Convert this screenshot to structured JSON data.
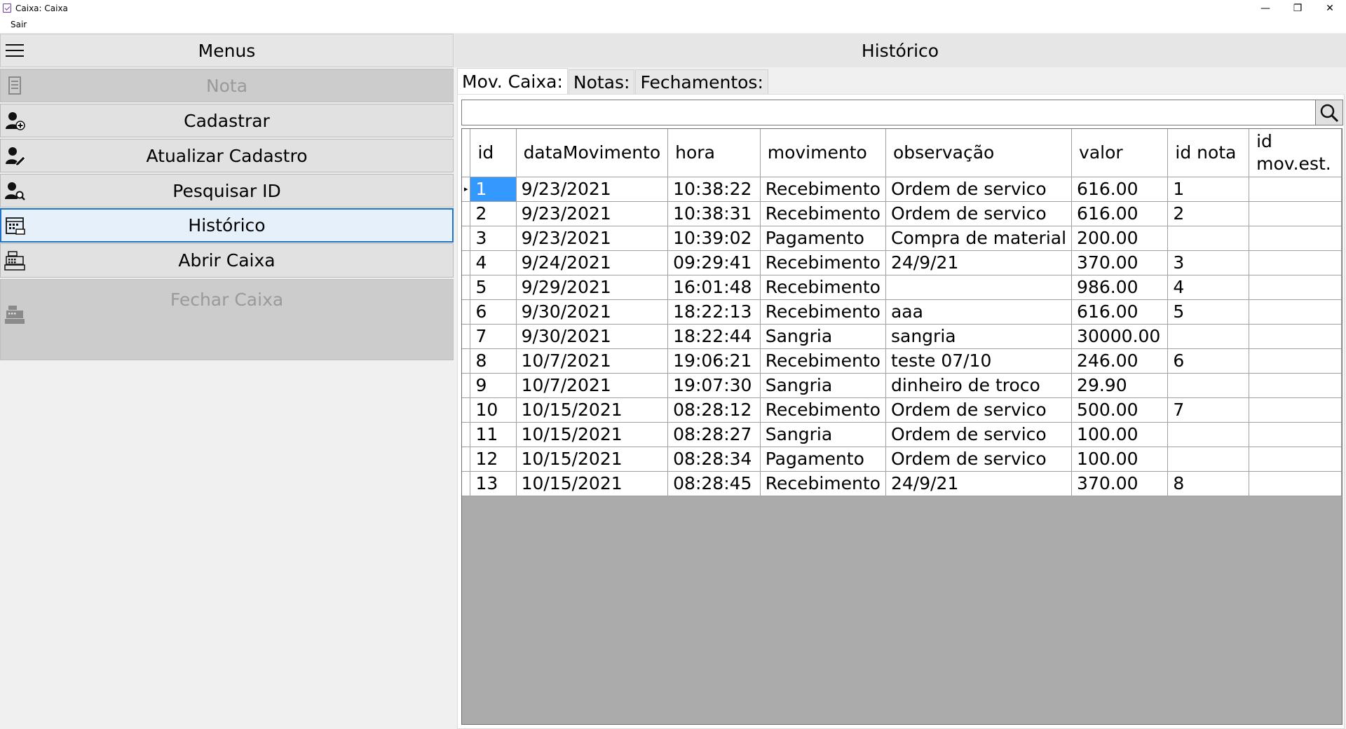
{
  "window": {
    "title": "Caixa: Caixa",
    "minimize_glyph": "—",
    "restore_glyph": "❐",
    "close_glyph": "✕"
  },
  "menubar": {
    "items": [
      "Sair"
    ]
  },
  "sidebar": {
    "header": "Menus",
    "items": [
      {
        "label": "Nota",
        "icon": "receipt-icon",
        "enabled": false
      },
      {
        "label": "Cadastrar",
        "icon": "user-add-icon",
        "enabled": true
      },
      {
        "label": "Atualizar Cadastro",
        "icon": "user-edit-icon",
        "enabled": true
      },
      {
        "label": "Pesquisar ID",
        "icon": "user-search-icon",
        "enabled": true
      },
      {
        "label": "Histórico",
        "icon": "history-icon",
        "enabled": true,
        "focused": true
      },
      {
        "label": "Abrir Caixa",
        "icon": "cash-register-icon",
        "enabled": true
      },
      {
        "label": "Fechar Caixa",
        "icon": "cash-register-icon",
        "enabled": false
      }
    ]
  },
  "main": {
    "header": "Histórico",
    "tabs": [
      "Mov. Caixa:",
      "Notas:",
      "Fechamentos:"
    ],
    "active_tab": 0,
    "search": {
      "value": "",
      "placeholder": ""
    },
    "grid": {
      "columns": [
        "id",
        "dataMovimento",
        "hora",
        "movimento",
        "observação",
        "valor",
        "id nota",
        "id mov.est."
      ],
      "rows": [
        [
          "1",
          "9/23/2021",
          "10:38:22",
          "Recebimento",
          "Ordem de servico",
          "616.00",
          "1",
          ""
        ],
        [
          "2",
          "9/23/2021",
          "10:38:31",
          "Recebimento",
          "Ordem de servico",
          "616.00",
          "2",
          ""
        ],
        [
          "3",
          "9/23/2021",
          "10:39:02",
          "Pagamento",
          "Compra de material",
          "200.00",
          "",
          ""
        ],
        [
          "4",
          "9/24/2021",
          "09:29:41",
          "Recebimento",
          "24/9/21",
          "370.00",
          "3",
          ""
        ],
        [
          "5",
          "9/29/2021",
          "16:01:48",
          "Recebimento",
          "",
          "986.00",
          "4",
          ""
        ],
        [
          "6",
          "9/30/2021",
          "18:22:13",
          "Recebimento",
          "aaa",
          "616.00",
          "5",
          ""
        ],
        [
          "7",
          "9/30/2021",
          "18:22:44",
          "Sangria",
          "sangria",
          "30000.00",
          "",
          ""
        ],
        [
          "8",
          "10/7/2021",
          "19:06:21",
          "Recebimento",
          "teste 07/10",
          "246.00",
          "6",
          ""
        ],
        [
          "9",
          "10/7/2021",
          "19:07:30",
          "Sangria",
          "dinheiro de troco",
          "29.90",
          "",
          ""
        ],
        [
          "10",
          "10/15/2021",
          "08:28:12",
          "Recebimento",
          "Ordem de servico",
          "500.00",
          "7",
          ""
        ],
        [
          "11",
          "10/15/2021",
          "08:28:27",
          "Sangria",
          "Ordem de servico",
          "100.00",
          "",
          ""
        ],
        [
          "12",
          "10/15/2021",
          "08:28:34",
          "Pagamento",
          "Ordem de servico",
          "100.00",
          "",
          ""
        ],
        [
          "13",
          "10/15/2021",
          "08:28:45",
          "Recebimento",
          "24/9/21",
          "370.00",
          "8",
          ""
        ]
      ],
      "selected_row": 0,
      "current_row_marker": "▸"
    }
  },
  "colors": {
    "selection": "#3399ff",
    "focus_border": "#1e73c9",
    "grid_empty": "#ababab"
  }
}
